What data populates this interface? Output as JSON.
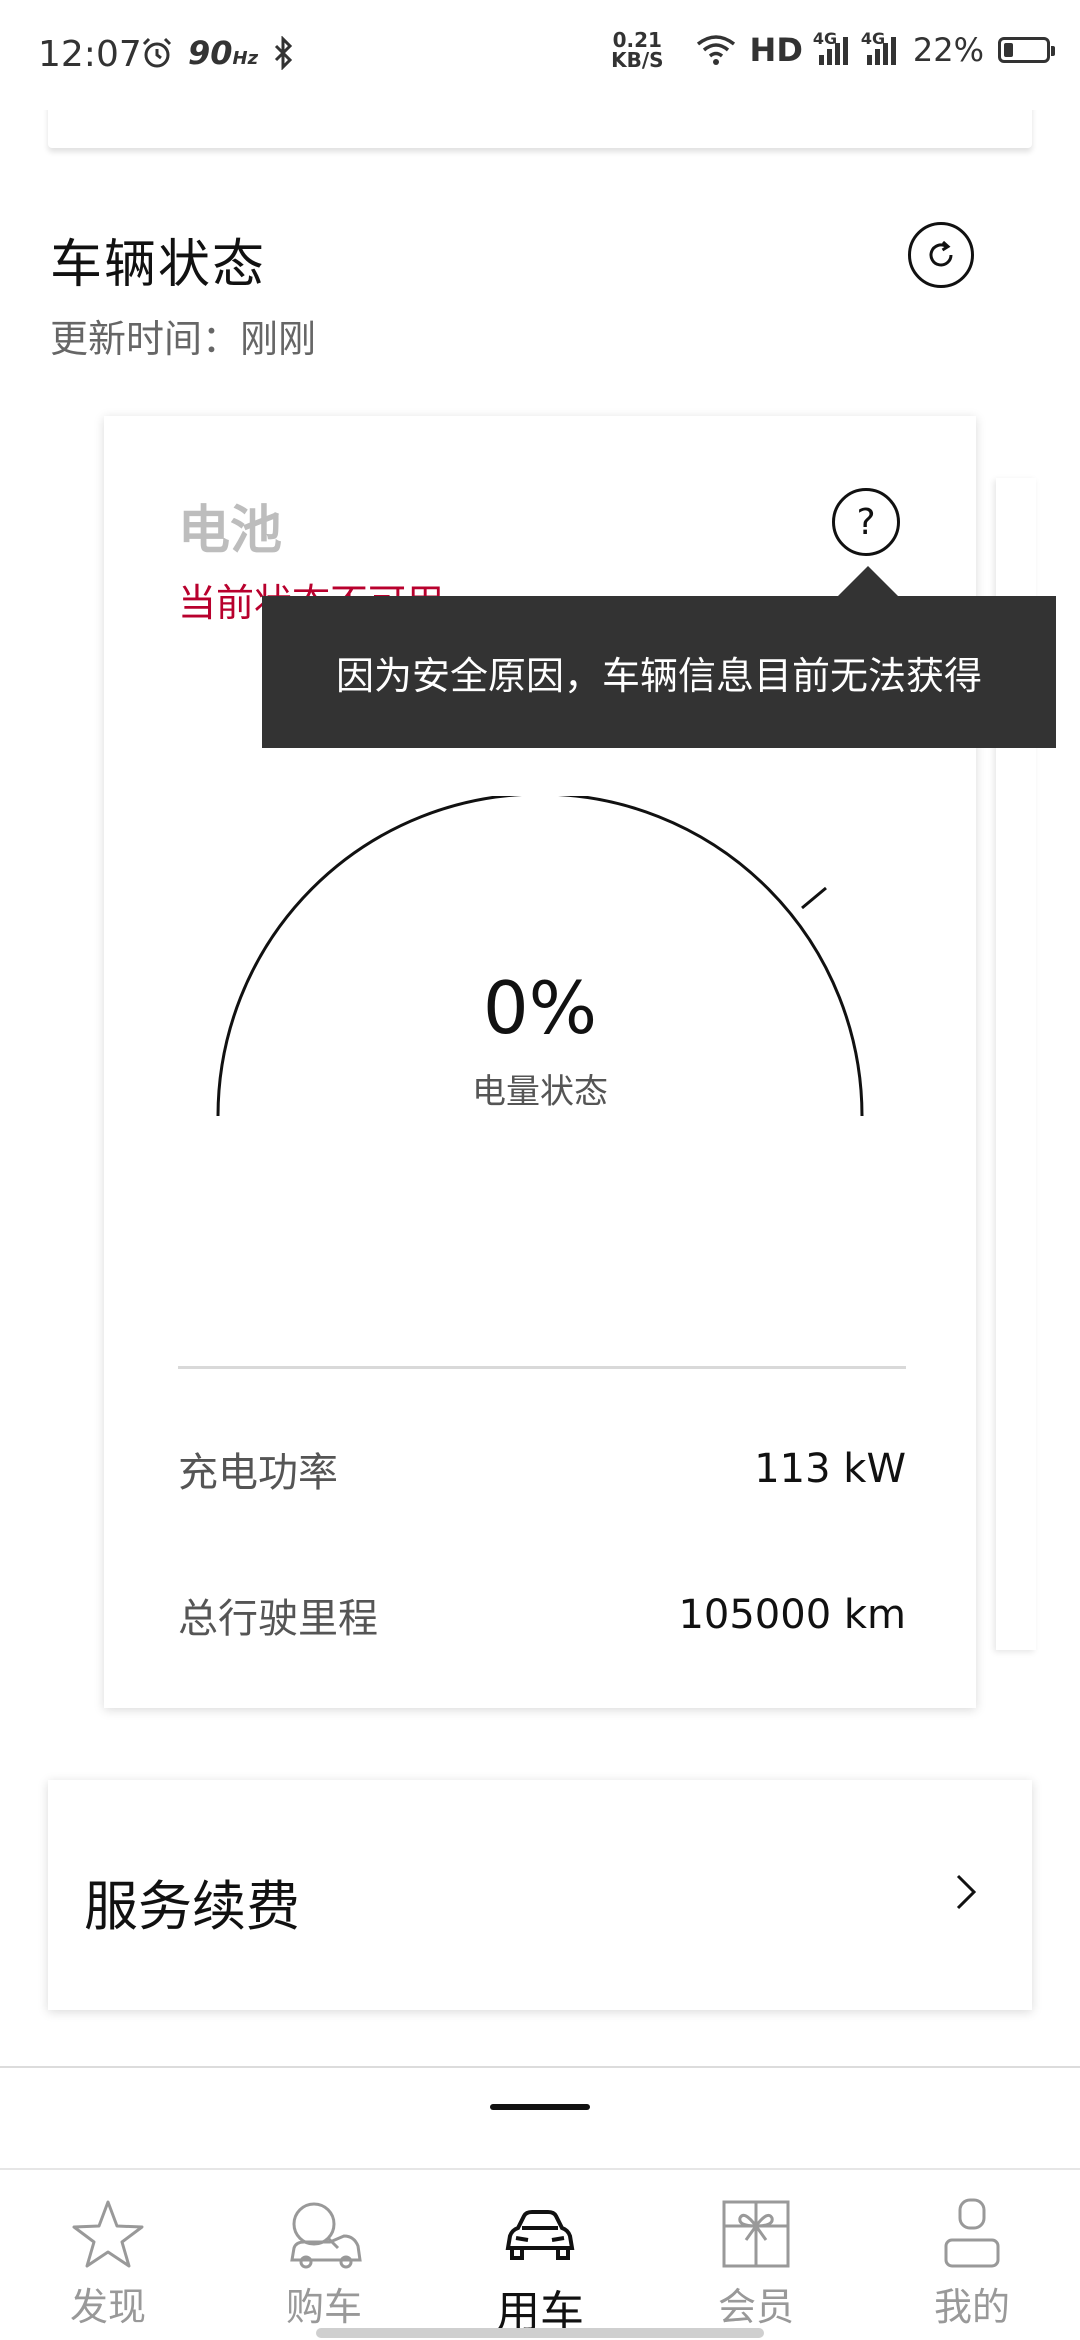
{
  "status_bar": {
    "time": "12:07",
    "refresh_rate": "90",
    "refresh_unit": "Hz",
    "net_speed_value": "0.21",
    "net_speed_unit": "KB/S",
    "hd_label": "HD",
    "network_type_1": "4G",
    "network_type_2": "4G",
    "battery_percent": "22%",
    "battery_level": 0.22
  },
  "vehicle_status": {
    "title": "车辆状态",
    "update_time": "更新时间：刚刚"
  },
  "battery_card": {
    "title": "电池",
    "status_text": "当前状态不可用",
    "tooltip": "因为安全原因，车辆信息目前无法获得",
    "help_label": "?",
    "charge_value": "0%",
    "charge_label": "电量状态",
    "metrics": [
      {
        "label": "充电功率",
        "value": "113 kW"
      },
      {
        "label": "总行驶里程",
        "value": "105000 km"
      }
    ]
  },
  "service_card": {
    "title": "服务续费"
  },
  "bottom_nav": {
    "items": [
      {
        "label": "发现",
        "icon": "star-icon"
      },
      {
        "label": "购车",
        "icon": "car-search-icon"
      },
      {
        "label": "用车",
        "icon": "car-icon"
      },
      {
        "label": "会员",
        "icon": "gift-icon"
      },
      {
        "label": "我的",
        "icon": "person-icon"
      }
    ],
    "active": "用车"
  },
  "colors": {
    "accent_red": "#b8002d",
    "tooltip_bg": "#333333",
    "inactive_gray": "#999999"
  }
}
